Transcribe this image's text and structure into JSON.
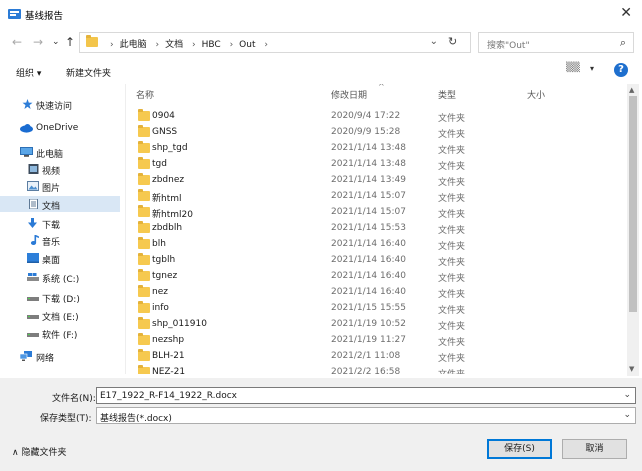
{
  "window": {
    "title": "基线报告",
    "close_glyph": "✕"
  },
  "nav": {
    "back": "←",
    "forward": "→",
    "recent": "⌄",
    "up": "↑",
    "breadcrumbs": [
      "此电脑",
      "文档",
      "HBC",
      "Out"
    ],
    "crumb_sep": "›",
    "address_dropdown": "⌄",
    "refresh": "↻",
    "search_placeholder": "搜索\"Out\"",
    "search_icon": "⌕"
  },
  "toolbar": {
    "organize": "组织 ▾",
    "new_folder": "新建文件夹",
    "view_icon": "▒▒",
    "view_dropdown": "▾",
    "help": "?"
  },
  "sidebar": {
    "items": [
      {
        "label": "快速访问",
        "icon": "star-icon"
      },
      {
        "label": "OneDrive",
        "icon": "cloud-icon"
      },
      {
        "label": "此电脑",
        "icon": "computer-icon"
      },
      {
        "label": "视频",
        "icon": "video-icon"
      },
      {
        "label": "图片",
        "icon": "pictures-icon"
      },
      {
        "label": "文档",
        "icon": "documents-icon"
      },
      {
        "label": "下载",
        "icon": "download-icon"
      },
      {
        "label": "音乐",
        "icon": "music-icon"
      },
      {
        "label": "桌面",
        "icon": "desktop-icon"
      },
      {
        "label": "系统 (C:)",
        "icon": "drive-icon"
      },
      {
        "label": "下载 (D:)",
        "icon": "drive-icon"
      },
      {
        "label": "文档 (E:)",
        "icon": "drive-icon"
      },
      {
        "label": "软件 (F:)",
        "icon": "drive-icon"
      },
      {
        "label": "网络",
        "icon": "network-icon"
      }
    ],
    "selected": "文档"
  },
  "columns": {
    "name": "名称",
    "modified": "修改日期",
    "type": "类型",
    "size": "大小",
    "sort_caret": "^"
  },
  "files": [
    {
      "name": "0904",
      "date": "2020/9/4 17:22",
      "type": "文件夹"
    },
    {
      "name": "GNSS",
      "date": "2020/9/9 15:28",
      "type": "文件夹"
    },
    {
      "name": "shp_tgd",
      "date": "2021/1/14 13:48",
      "type": "文件夹"
    },
    {
      "name": "tgd",
      "date": "2021/1/14 13:48",
      "type": "文件夹"
    },
    {
      "name": "zbdnez",
      "date": "2021/1/14 13:49",
      "type": "文件夹"
    },
    {
      "name": "新html",
      "date": "2021/1/14 15:07",
      "type": "文件夹"
    },
    {
      "name": "新html20",
      "date": "2021/1/14 15:07",
      "type": "文件夹"
    },
    {
      "name": "zbdblh",
      "date": "2021/1/14 15:53",
      "type": "文件夹"
    },
    {
      "name": "blh",
      "date": "2021/1/14 16:40",
      "type": "文件夹"
    },
    {
      "name": "tgblh",
      "date": "2021/1/14 16:40",
      "type": "文件夹"
    },
    {
      "name": "tgnez",
      "date": "2021/1/14 16:40",
      "type": "文件夹"
    },
    {
      "name": "nez",
      "date": "2021/1/14 16:40",
      "type": "文件夹"
    },
    {
      "name": "info",
      "date": "2021/1/15 15:55",
      "type": "文件夹"
    },
    {
      "name": "shp_011910",
      "date": "2021/1/19 10:52",
      "type": "文件夹"
    },
    {
      "name": "nezshp",
      "date": "2021/1/19 11:27",
      "type": "文件夹"
    },
    {
      "name": "BLH-21",
      "date": "2021/2/1 11:08",
      "type": "文件夹"
    },
    {
      "name": "NEZ-21",
      "date": "2021/2/2 16:58",
      "type": "文件夹"
    }
  ],
  "scrollbar": {
    "up": "▲",
    "down": "▼"
  },
  "save": {
    "filename_label": "文件名(N):",
    "filename_value": "E17_1922_R-F14_1922_R.docx",
    "type_label": "保存类型(T):",
    "type_value": "基线报告(*.docx)",
    "dropdown": "⌄",
    "hide_folders": "∧  隐藏文件夹",
    "save_button": "保存(S)",
    "cancel_button": "取消"
  }
}
